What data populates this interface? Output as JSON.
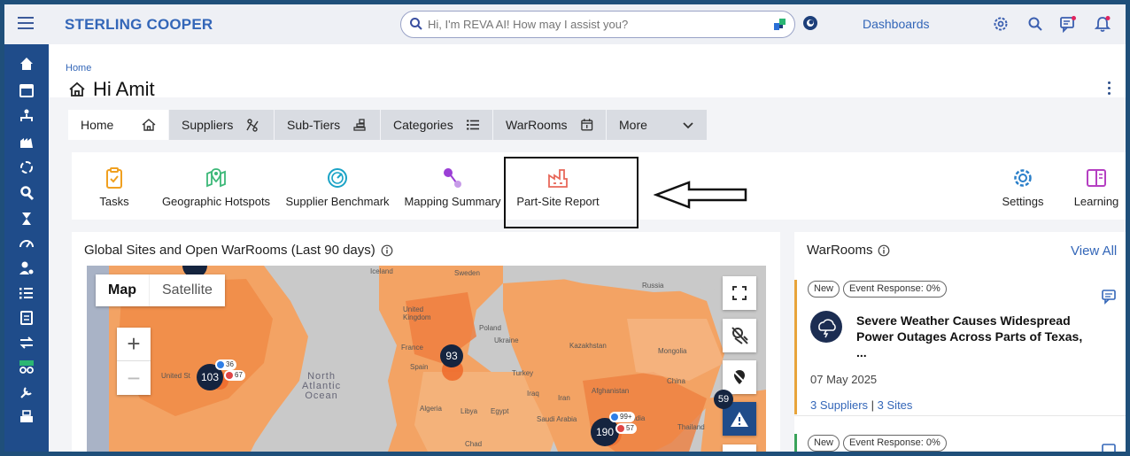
{
  "header": {
    "brand": "STERLING COOPER",
    "search_placeholder": "Hi, I'm REVA AI! How may I assist you?",
    "dashboards_label": "Dashboards"
  },
  "breadcrumb": "Home",
  "greeting": "Hi Amit",
  "tabs": [
    {
      "label": "Home",
      "icon": "home-icon",
      "active": true
    },
    {
      "label": "Suppliers",
      "icon": "supplier-icon"
    },
    {
      "label": "Sub-Tiers",
      "icon": "tiers-icon"
    },
    {
      "label": "Categories",
      "icon": "list-icon"
    },
    {
      "label": "WarRooms",
      "icon": "calendar-icon"
    },
    {
      "label": "More",
      "icon": "chevron-down-icon"
    }
  ],
  "tools": [
    {
      "label": "Tasks",
      "icon": "clipboard-icon",
      "color": "#f0a020"
    },
    {
      "label": "Geographic Hotspots",
      "icon": "map-pin-icon",
      "color": "#3cb878"
    },
    {
      "label": "Supplier Benchmark",
      "icon": "gauge-icon",
      "color": "#1ba3c6"
    },
    {
      "label": "Mapping Summary",
      "icon": "mapping-icon",
      "color": "#9b3fd6"
    },
    {
      "label": "Part-Site Report",
      "icon": "factory-icon",
      "color": "#e8685a"
    }
  ],
  "tools_right": [
    {
      "label": "Settings",
      "icon": "gear-icon",
      "color": "#2a7fc9"
    },
    {
      "label": "Learning",
      "icon": "book-icon",
      "color": "#b53fc2"
    }
  ],
  "map_card": {
    "title": "Global Sites and Open WarRooms (Last 90 days)",
    "toggle": [
      "Map",
      "Satellite"
    ],
    "zoom_in": "+",
    "zoom_out": "−",
    "clusters": [
      {
        "label": "103",
        "blue": "36",
        "red": "67"
      },
      {
        "label": "93"
      },
      {
        "label": "190",
        "blue": "99+",
        "red": "57"
      },
      {
        "label": "59"
      }
    ],
    "places": [
      "Iceland",
      "Sweden",
      "Russia",
      "United Kingdom",
      "Poland",
      "Ukraine",
      "Kazakhstan",
      "Mongolia",
      "France",
      "Spain",
      "Turkey",
      "China",
      "Iraq",
      "Iran",
      "Afghanistan",
      "Algeria",
      "Libya",
      "Egypt",
      "Saudi Arabia",
      "India",
      "Chad",
      "Thailand",
      "United St"
    ],
    "ocean": [
      "North",
      "Atlantic",
      "Ocean"
    ]
  },
  "warrooms": {
    "title": "WarRooms",
    "view_all": "View All",
    "items": [
      {
        "badges": [
          "New",
          "Event Response: 0%"
        ],
        "title": "Severe Weather Causes Widespread Power Outages Across Parts of Texas, ...",
        "date": "07 May 2025",
        "suppliers": "3 Suppliers",
        "sites": "3 Sites",
        "accent": "#e8a43a"
      },
      {
        "badges": [
          "New",
          "Event Response: 0%"
        ],
        "accent": "#3aa35a"
      }
    ]
  },
  "colors": {
    "brand": "#3366b8",
    "sidebar": "#1f4c8a",
    "map_land": "#f3a364",
    "cluster": "#15243f"
  }
}
